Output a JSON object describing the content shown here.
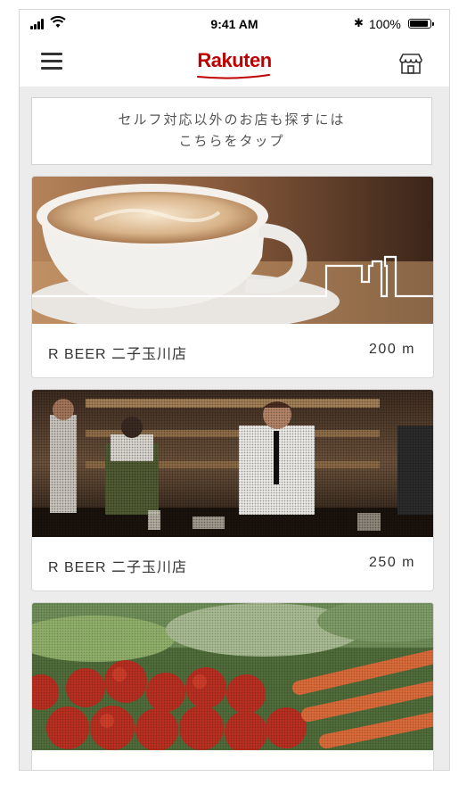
{
  "status_bar": {
    "time": "9:41 AM",
    "battery_text": "100%",
    "battery_level": 1.0,
    "icons": [
      "cellular-signal-icon",
      "wifi-icon",
      "bluetooth-icon",
      "battery-icon"
    ]
  },
  "header": {
    "logo_text": "Rakuten",
    "brand_color": "#bf0000",
    "icons": [
      "menu-icon",
      "store-icon"
    ]
  },
  "banner": {
    "line1": "セルフ対応以外のお店も探すには",
    "line2": "こちらをタップ"
  },
  "shops": [
    {
      "name": "R BEER 二子玉川店",
      "distance": "200 m",
      "photo": "coffee-cup"
    },
    {
      "name": "R BEER 二子玉川店",
      "distance": "250 m",
      "photo": "bar-staff"
    },
    {
      "name": "",
      "distance": "",
      "photo": "vegetables"
    }
  ]
}
